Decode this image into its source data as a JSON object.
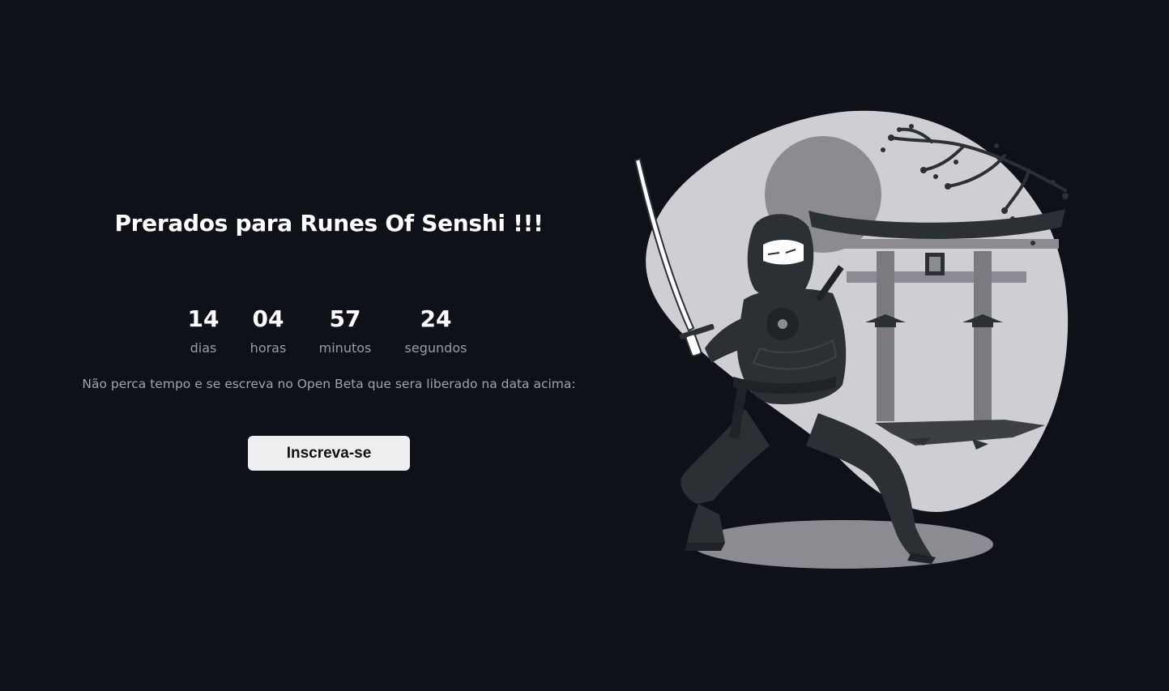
{
  "header": {
    "title": "Prerados para Runes Of Senshi !!!"
  },
  "countdown": {
    "days": {
      "value": "14",
      "label": "dias"
    },
    "hours": {
      "value": "04",
      "label": "horas"
    },
    "minutes": {
      "value": "57",
      "label": "minutos"
    },
    "seconds": {
      "value": "24",
      "label": "segundos"
    }
  },
  "message": "Não perca tempo e se escreva no Open Beta que sera liberado na data acima:",
  "cta": {
    "label": "Inscreva-se"
  },
  "colors": {
    "background": "#0e1117",
    "text_primary": "#ffffff",
    "text_muted": "#a1a3aa",
    "button_bg": "#efeff1",
    "button_text": "#111111"
  },
  "illustration": {
    "icon": "ninja-illustration"
  }
}
